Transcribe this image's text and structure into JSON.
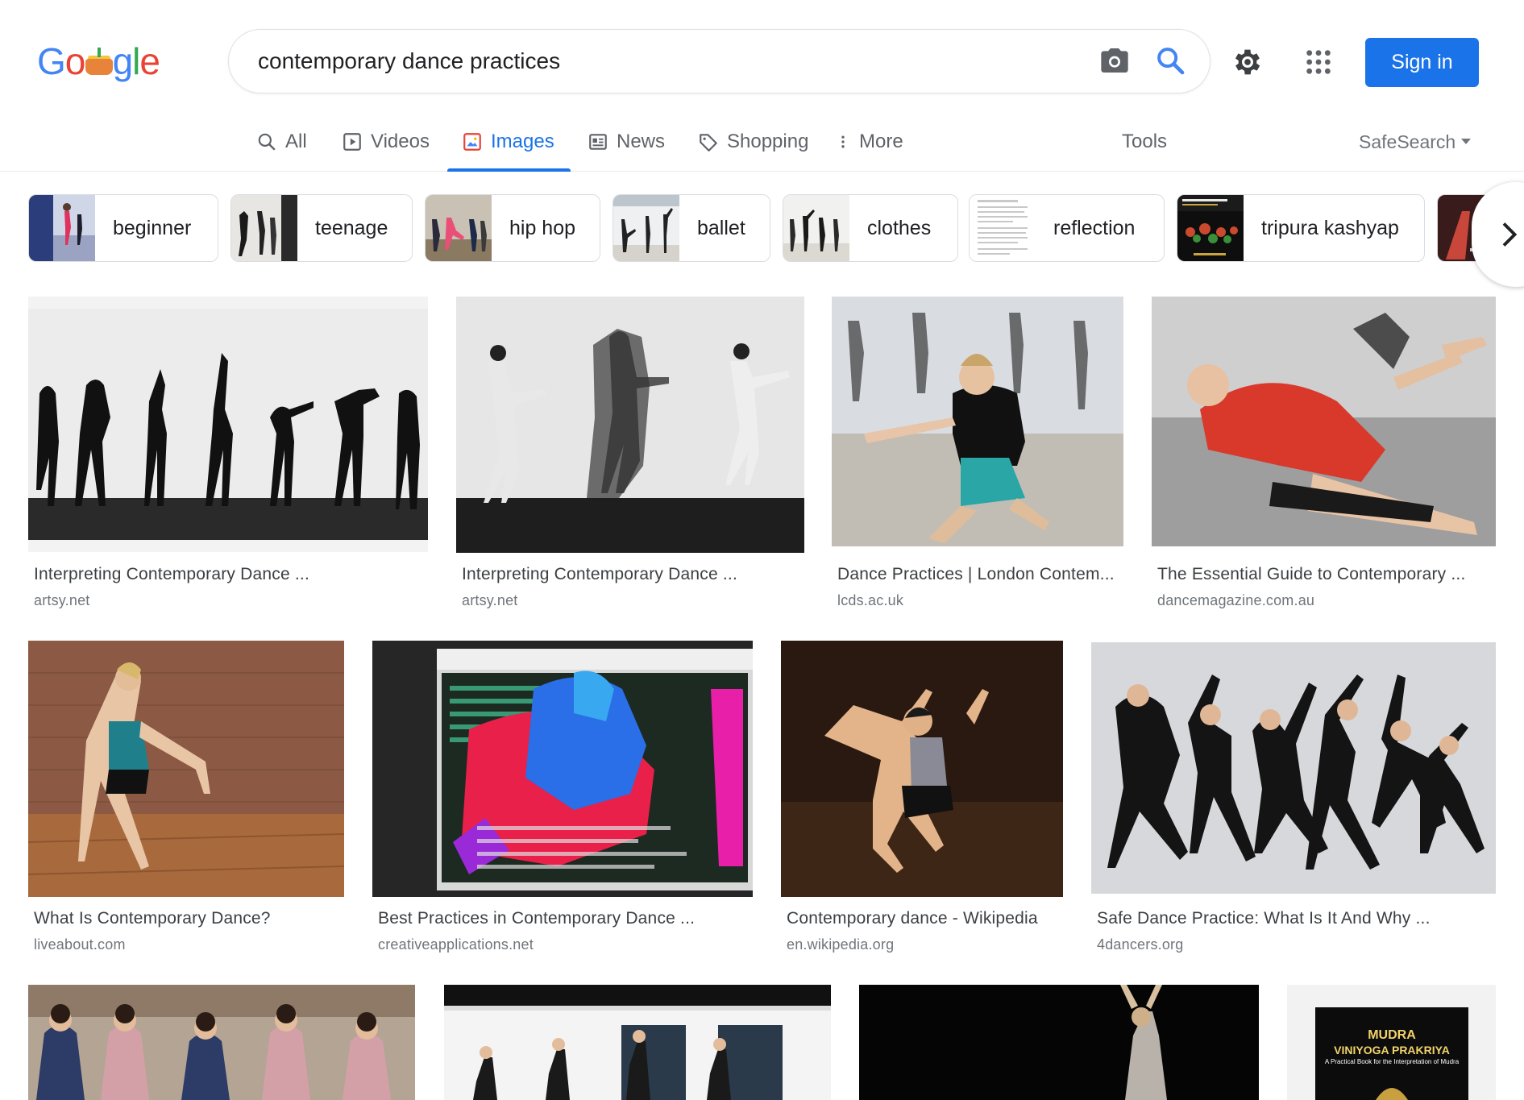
{
  "logo": {
    "letters": [
      "G",
      "o",
      "g",
      "l",
      "e"
    ],
    "colors": [
      "#4285f4",
      "#ea4335",
      "#4285f4",
      "#34a853",
      "#ea4335"
    ]
  },
  "search": {
    "query": "contemporary dance practices"
  },
  "header": {
    "signin_label": "Sign in"
  },
  "tabs": [
    {
      "label": "All",
      "icon": "search-icon",
      "active": false
    },
    {
      "label": "Videos",
      "icon": "play-icon",
      "active": false
    },
    {
      "label": "Images",
      "icon": "image-icon",
      "active": true
    },
    {
      "label": "News",
      "icon": "newspaper-icon",
      "active": false
    },
    {
      "label": "Shopping",
      "icon": "tag-icon",
      "active": false
    },
    {
      "label": "More",
      "icon": "more-vert-icon",
      "active": false
    }
  ],
  "tools_label": "Tools",
  "safesearch_label": "SafeSearch",
  "chips": [
    {
      "label": "beginner"
    },
    {
      "label": "teenage"
    },
    {
      "label": "hip hop"
    },
    {
      "label": "ballet"
    },
    {
      "label": "clothes"
    },
    {
      "label": "reflection"
    },
    {
      "label": "tripura kashyap"
    }
  ],
  "results": [
    {
      "title": "Interpreting Contemporary Dance ...",
      "source": "artsy.net"
    },
    {
      "title": "Interpreting Contemporary Dance ...",
      "source": "artsy.net"
    },
    {
      "title": "Dance Practices | London Contem...",
      "source": "lcds.ac.uk"
    },
    {
      "title": "The Essential Guide to Contemporary ...",
      "source": "dancemagazine.com.au"
    },
    {
      "title": "What Is Contemporary Dance?",
      "source": "liveabout.com"
    },
    {
      "title": "Best Practices in Contemporary Dance ...",
      "source": "creativeapplications.net"
    },
    {
      "title": "Contemporary dance - Wikipedia",
      "source": "en.wikipedia.org"
    },
    {
      "title": "Safe Dance Practice: What Is It And Why ...",
      "source": "4dancers.org"
    }
  ],
  "book_cover": {
    "line1": "MUDRA",
    "line2": "VINIYOGA PRAKRIYA",
    "line3": "A Practical Book for the Interpretation of Mudra"
  },
  "colors": {
    "accent": "#1a73e8",
    "border": "#dadce0"
  }
}
